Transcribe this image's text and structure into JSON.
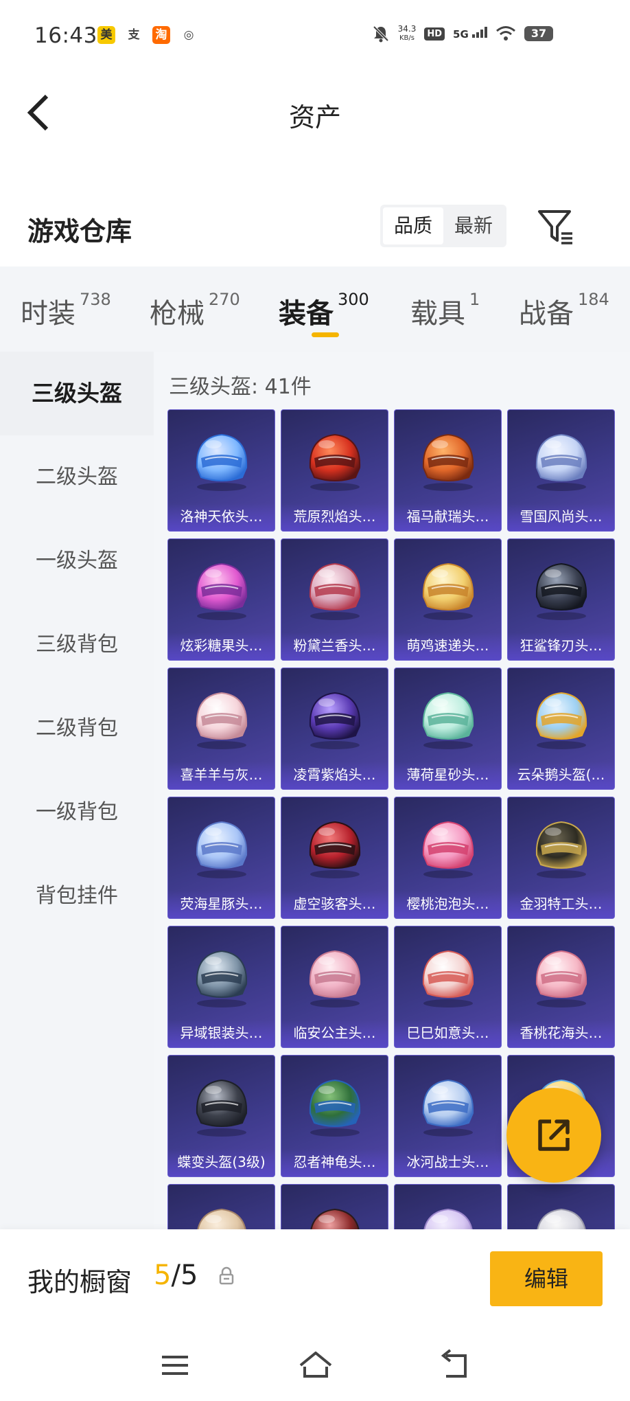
{
  "status_bar": {
    "time": "16:43",
    "apps": [
      {
        "icon": "meituan-icon",
        "glyph": "美",
        "bg": "#f7c900",
        "fg": "#333333"
      },
      {
        "icon": "alipay-icon",
        "glyph": "支",
        "bg": "#ffffff",
        "fg": "#444444"
      },
      {
        "icon": "taobao-icon",
        "glyph": "淘",
        "bg": "#ff6a00",
        "fg": "#ffffff"
      },
      {
        "icon": "app-swirl-icon",
        "glyph": "◎",
        "bg": "#ffffff",
        "fg": "#444444"
      }
    ],
    "net_speed_value": "34.3",
    "net_speed_unit": "KB/s",
    "hd": "HD",
    "network": "5G",
    "battery": "37"
  },
  "header": {
    "title": "资产"
  },
  "warehouse": {
    "title": "游戏仓库",
    "sort_options": [
      "品质",
      "最新"
    ],
    "sort_active": "品质"
  },
  "tabs": [
    {
      "label": "时装",
      "count": "738"
    },
    {
      "label": "枪械",
      "count": "270"
    },
    {
      "label": "装备",
      "count": "300"
    },
    {
      "label": "载具",
      "count": "1"
    },
    {
      "label": "战备",
      "count": "184"
    }
  ],
  "sidebar": [
    {
      "label": "三级头盔"
    },
    {
      "label": "二级头盔"
    },
    {
      "label": "一级头盔"
    },
    {
      "label": "三级背包"
    },
    {
      "label": "二级背包"
    },
    {
      "label": "一级背包"
    },
    {
      "label": "背包挂件"
    }
  ],
  "grid": {
    "count_label": "三级头盔: 41件",
    "items": [
      {
        "name": "洛神天依头…",
        "c1": "#dfe9ff",
        "c2": "#7fb8ff",
        "c3": "#2b6cd6"
      },
      {
        "name": "荒原烈焰头…",
        "c1": "#ff8a5a",
        "c2": "#d7311f",
        "c3": "#5a1414"
      },
      {
        "name": "福马献瑞头…",
        "c1": "#ffb36a",
        "c2": "#e2682a",
        "c3": "#7a2a10"
      },
      {
        "name": "雪国风尚头…",
        "c1": "#f2f6ff",
        "c2": "#c5d4f5",
        "c3": "#6b7fbf"
      },
      {
        "name": "炫彩糖果头…",
        "c1": "#ffc6f0",
        "c2": "#e15ad0",
        "c3": "#7b2d9a"
      },
      {
        "name": "粉黛兰香头…",
        "c1": "#ffeef3",
        "c2": "#dba9bd",
        "c3": "#b43a4e"
      },
      {
        "name": "萌鸡速递头…",
        "c1": "#fff7d2",
        "c2": "#f2cf6e",
        "c3": "#c8842b"
      },
      {
        "name": "狂鲨锋刃头…",
        "c1": "#9aa5b8",
        "c2": "#3b4152",
        "c3": "#141720"
      },
      {
        "name": "喜羊羊与灰…",
        "c1": "#ffffff",
        "c2": "#f6d6dc",
        "c3": "#c58a98"
      },
      {
        "name": "凌霄紫焰头…",
        "c1": "#b9a0ff",
        "c2": "#5b3bb4",
        "c3": "#1e1447"
      },
      {
        "name": "薄荷星砂头…",
        "c1": "#f3fff9",
        "c2": "#bfeee0",
        "c3": "#5ab39a"
      },
      {
        "name": "云朵鹅头盔(…",
        "c1": "#eaf5ff",
        "c2": "#9dd0f2",
        "c3": "#e3a52a"
      },
      {
        "name": "荧海星豚头…",
        "c1": "#e9f2ff",
        "c2": "#aac6f7",
        "c3": "#5a78c9"
      },
      {
        "name": "虚空骇客头…",
        "c1": "#f27b7b",
        "c2": "#b7212c",
        "c3": "#2a1014"
      },
      {
        "name": "樱桃泡泡头…",
        "c1": "#ffe1ef",
        "c2": "#f59bc3",
        "c3": "#d3416f"
      },
      {
        "name": "金羽特工头…",
        "c1": "#6a6450",
        "c2": "#2d2b22",
        "c3": "#c9a84e"
      },
      {
        "name": "异域银装头…",
        "c1": "#dfe9f2",
        "c2": "#7e93a7",
        "c3": "#2b3d52"
      },
      {
        "name": "临安公主头…",
        "c1": "#ffeef3",
        "c2": "#f1b3c6",
        "c3": "#c77990"
      },
      {
        "name": "巳巳如意头…",
        "c1": "#ffffff",
        "c2": "#f3d2d0",
        "c3": "#d65a55"
      },
      {
        "name": "香桃花海头…",
        "c1": "#fff2f5",
        "c2": "#f6b8c6",
        "c3": "#cf6e86"
      },
      {
        "name": "蝶变头盔(3级)",
        "c1": "#b7bcc7",
        "c2": "#3d414c",
        "c3": "#1d2028"
      },
      {
        "name": "忍者神龟头…",
        "c1": "#86c27a",
        "c2": "#2f6f3a",
        "c3": "#2563b8"
      },
      {
        "name": "冰河战士头…",
        "c1": "#f1f6ff",
        "c2": "#b7cef0",
        "c3": "#3c6cc4"
      },
      {
        "name": "",
        "c1": "#fff6d8",
        "c2": "#ffdd7a",
        "c3": "#5aa6e8"
      },
      {
        "name": "",
        "c1": "#fbeedd",
        "c2": "#e2c9a8",
        "c3": "#a5846a"
      },
      {
        "name": "",
        "c1": "#f0a4a4",
        "c2": "#8c2a2a",
        "c3": "#2b1b1b"
      },
      {
        "name": "",
        "c1": "#f4efff",
        "c2": "#d7c7f3",
        "c3": "#9d87cc"
      },
      {
        "name": "",
        "c1": "#fafafa",
        "c2": "#dcdce4",
        "c3": "#9a9aab"
      }
    ]
  },
  "bottom": {
    "window_label": "我的橱窗",
    "window_current": "5",
    "window_separator": "/",
    "window_total": "5",
    "edit_label": "编辑"
  },
  "colors": {
    "accent": "#f9b414",
    "card_bg": "#3d3a8a"
  }
}
